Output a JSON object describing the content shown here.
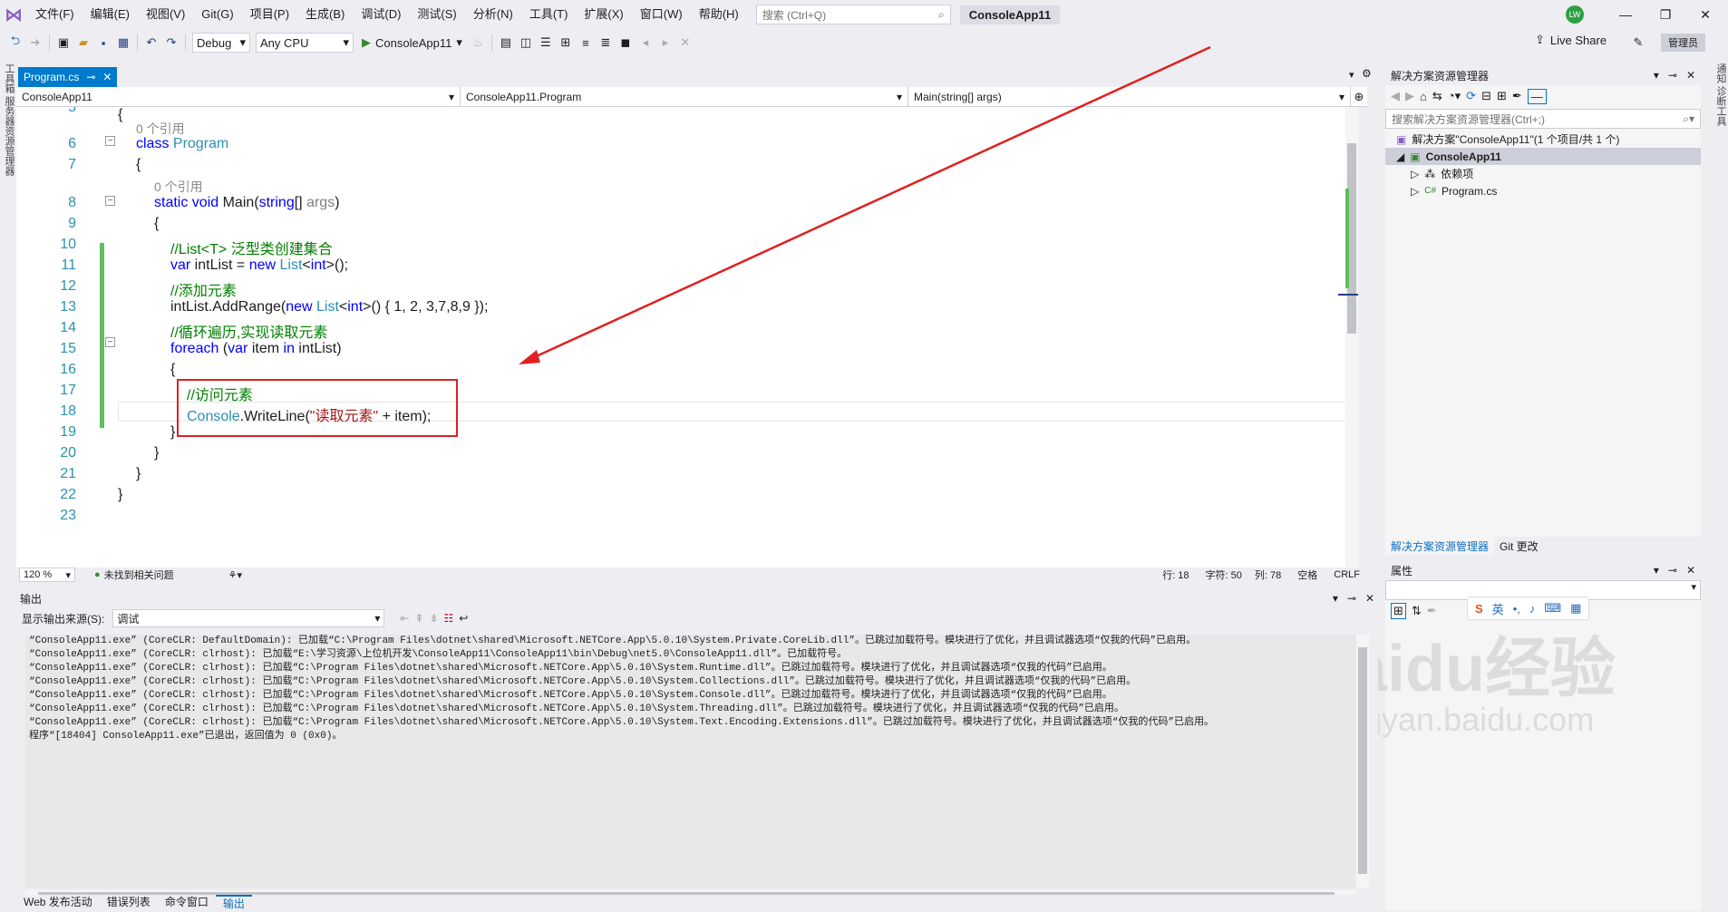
{
  "menubar": {
    "items": [
      "文件(F)",
      "编辑(E)",
      "视图(V)",
      "Git(G)",
      "项目(P)",
      "生成(B)",
      "调试(D)",
      "测试(S)",
      "分析(N)",
      "工具(T)",
      "扩展(X)",
      "窗口(W)",
      "帮助(H)"
    ],
    "search_placeholder": "搜索 (Ctrl+Q)",
    "project_name": "ConsoleApp11",
    "avatar": "LW"
  },
  "toolbar": {
    "config": "Debug",
    "platform": "Any CPU",
    "run_label": "ConsoleApp11",
    "live_share": "Live Share",
    "admin": "管理员"
  },
  "leftstrip": {
    "label": "工具箱 服务器资源管理器"
  },
  "rightstrip": {
    "label": "通知 诊断工具"
  },
  "editor": {
    "tab": "Program.cs",
    "nav_project": "ConsoleApp11",
    "nav_class": "ConsoleApp11.Program",
    "nav_member": "Main(string[] args)",
    "zoom": "120 %",
    "issues": "未找到相关问题",
    "line": "行: 18",
    "char": "字符: 50",
    "col": "列: 78",
    "space": "空格",
    "eol": "CRLF",
    "line_numbers": [
      "5",
      "6",
      "7",
      "8",
      "9",
      "10",
      "11",
      "12",
      "13",
      "14",
      "15",
      "16",
      "17",
      "18",
      "19",
      "20",
      "21",
      "22",
      "23"
    ],
    "refs": [
      "0 个引用",
      "0 个引用"
    ],
    "code": {
      "l5": "{",
      "l6_kw": "class",
      "l6_ty": "Program",
      "l7": "{",
      "l8_kw": "static void",
      "l8_fn": " Main(",
      "l8_kw2": "string",
      "l8_p": "[] ",
      "l8_arg": "args",
      "l8_end": ")",
      "l9": "{",
      "l10": "//List<T> 泛型类创建集合",
      "l11_kw": "var",
      "l11_a": " intList = ",
      "l11_kw2": "new",
      "l11_ty": " List",
      "l11_b": "<",
      "l11_kw3": "int",
      "l11_c": ">();",
      "l12": "//添加元素",
      "l13_a": "intList.AddRange(",
      "l13_kw": "new",
      "l13_ty": " List",
      "l13_b": "<",
      "l13_kw2": "int",
      "l13_c": ">() { 1, 2, 3,7,8,9 });",
      "l14": "//循环遍历,实现读取元素",
      "l15_kw": "foreach",
      "l15_a": " (",
      "l15_kw2": "var",
      "l15_b": " item ",
      "l15_kw3": "in",
      "l15_c": " intList)",
      "l16": "{",
      "l17": "//访问元素",
      "l18_ty": "Console",
      "l18_a": ".WriteLine(",
      "l18_st": "\"读取元素\"",
      "l18_b": " + item);",
      "l19": "}",
      "l20": "}",
      "l21": "}",
      "l22": "}"
    }
  },
  "solution": {
    "title": "解决方案资源管理器",
    "search": "搜索解决方案资源管理器(Ctrl+;)",
    "root": "解决方案\"ConsoleApp11\"(1 个项目/共 1 个)",
    "project": "ConsoleApp11",
    "deps": "依赖项",
    "file": "Program.cs",
    "tab1": "解决方案资源管理器",
    "tab2": "Git 更改"
  },
  "properties": {
    "title": "属性"
  },
  "output": {
    "title": "输出",
    "source_label": "显示输出来源(S):",
    "source_value": "调试",
    "lines": [
      "“ConsoleApp11.exe” (CoreCLR: DefaultDomain): 已加载“C:\\Program Files\\dotnet\\shared\\Microsoft.NETCore.App\\5.0.10\\System.Private.CoreLib.dll”。已跳过加载符号。模块进行了优化，并且调试器选项“仅我的代码”已启用。",
      "“ConsoleApp11.exe” (CoreCLR: clrhost): 已加载“E:\\学习资源\\上位机开发\\ConsoleApp11\\ConsoleApp11\\bin\\Debug\\net5.0\\ConsoleApp11.dll”。已加载符号。",
      "“ConsoleApp11.exe” (CoreCLR: clrhost): 已加载“C:\\Program Files\\dotnet\\shared\\Microsoft.NETCore.App\\5.0.10\\System.Runtime.dll”。已跳过加载符号。模块进行了优化，并且调试器选项“仅我的代码”已启用。",
      "“ConsoleApp11.exe” (CoreCLR: clrhost): 已加载“C:\\Program Files\\dotnet\\shared\\Microsoft.NETCore.App\\5.0.10\\System.Collections.dll”。已跳过加载符号。模块进行了优化，并且调试器选项“仅我的代码”已启用。",
      "“ConsoleApp11.exe” (CoreCLR: clrhost): 已加载“C:\\Program Files\\dotnet\\shared\\Microsoft.NETCore.App\\5.0.10\\System.Console.dll”。已跳过加载符号。模块进行了优化，并且调试器选项“仅我的代码”已启用。",
      "“ConsoleApp11.exe” (CoreCLR: clrhost): 已加载“C:\\Program Files\\dotnet\\shared\\Microsoft.NETCore.App\\5.0.10\\System.Threading.dll”。已跳过加载符号。模块进行了优化，并且调试器选项“仅我的代码”已启用。",
      "“ConsoleApp11.exe” (CoreCLR: clrhost): 已加载“C:\\Program Files\\dotnet\\shared\\Microsoft.NETCore.App\\5.0.10\\System.Text.Encoding.Extensions.dll”。已跳过加载符号。模块进行了优化，并且调试器选项“仅我的代码”已启用。",
      "程序“[18404] ConsoleApp11.exe”已退出，返回值为 0 (0x0)。"
    ]
  },
  "bottomtabs": [
    "Web 发布活动",
    "错误列表",
    "命令窗口",
    "输出"
  ],
  "ime": {
    "label": "英"
  },
  "watermark": {
    "text": "Baidu经验",
    "sub": "jingyan.baidu.com"
  }
}
